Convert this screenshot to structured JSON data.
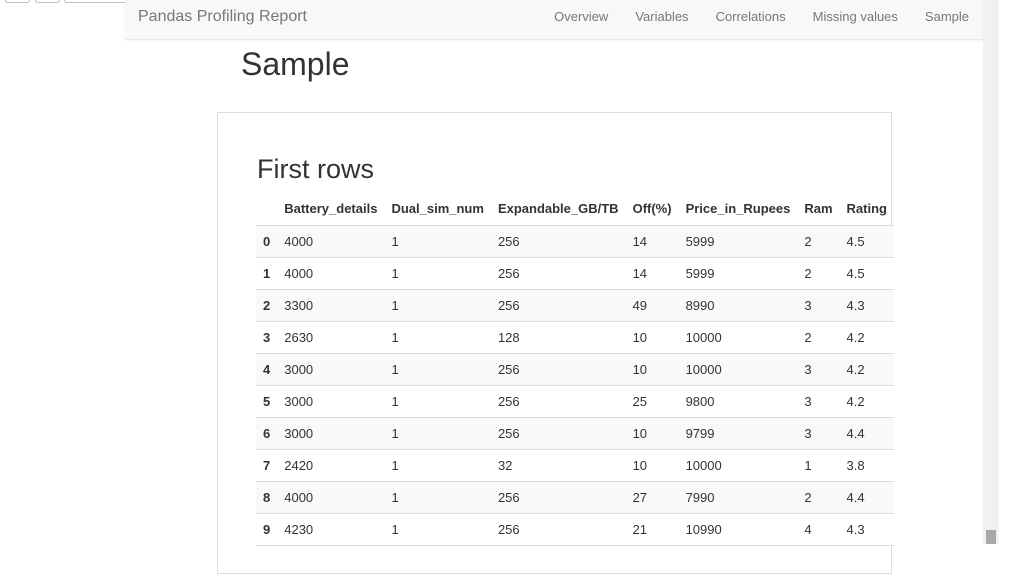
{
  "navbar": {
    "brand": "Pandas Profiling Report",
    "links": [
      "Overview",
      "Variables",
      "Correlations",
      "Missing values",
      "Sample"
    ]
  },
  "section": {
    "title": "Sample"
  },
  "panel": {
    "title": "First rows",
    "columns": [
      "",
      "Battery_details",
      "Dual_sim_num",
      "Expandable_GB/TB",
      "Off(%)",
      "Price_in_Rupees",
      "Ram",
      "Rating"
    ],
    "rows": [
      [
        "0",
        "4000",
        "1",
        "256",
        "14",
        "5999",
        "2",
        "4.5"
      ],
      [
        "1",
        "4000",
        "1",
        "256",
        "14",
        "5999",
        "2",
        "4.5"
      ],
      [
        "2",
        "3300",
        "1",
        "256",
        "49",
        "8990",
        "3",
        "4.3"
      ],
      [
        "3",
        "2630",
        "1",
        "128",
        "10",
        "10000",
        "2",
        "4.2"
      ],
      [
        "4",
        "3000",
        "1",
        "256",
        "10",
        "10000",
        "3",
        "4.2"
      ],
      [
        "5",
        "3000",
        "1",
        "256",
        "25",
        "9800",
        "3",
        "4.2"
      ],
      [
        "6",
        "3000",
        "1",
        "256",
        "10",
        "9799",
        "3",
        "4.4"
      ],
      [
        "7",
        "2420",
        "1",
        "32",
        "10",
        "10000",
        "1",
        "3.8"
      ],
      [
        "8",
        "4000",
        "1",
        "256",
        "27",
        "7990",
        "2",
        "4.4"
      ],
      [
        "9",
        "4230",
        "1",
        "256",
        "21",
        "10990",
        "4",
        "4.3"
      ]
    ]
  }
}
